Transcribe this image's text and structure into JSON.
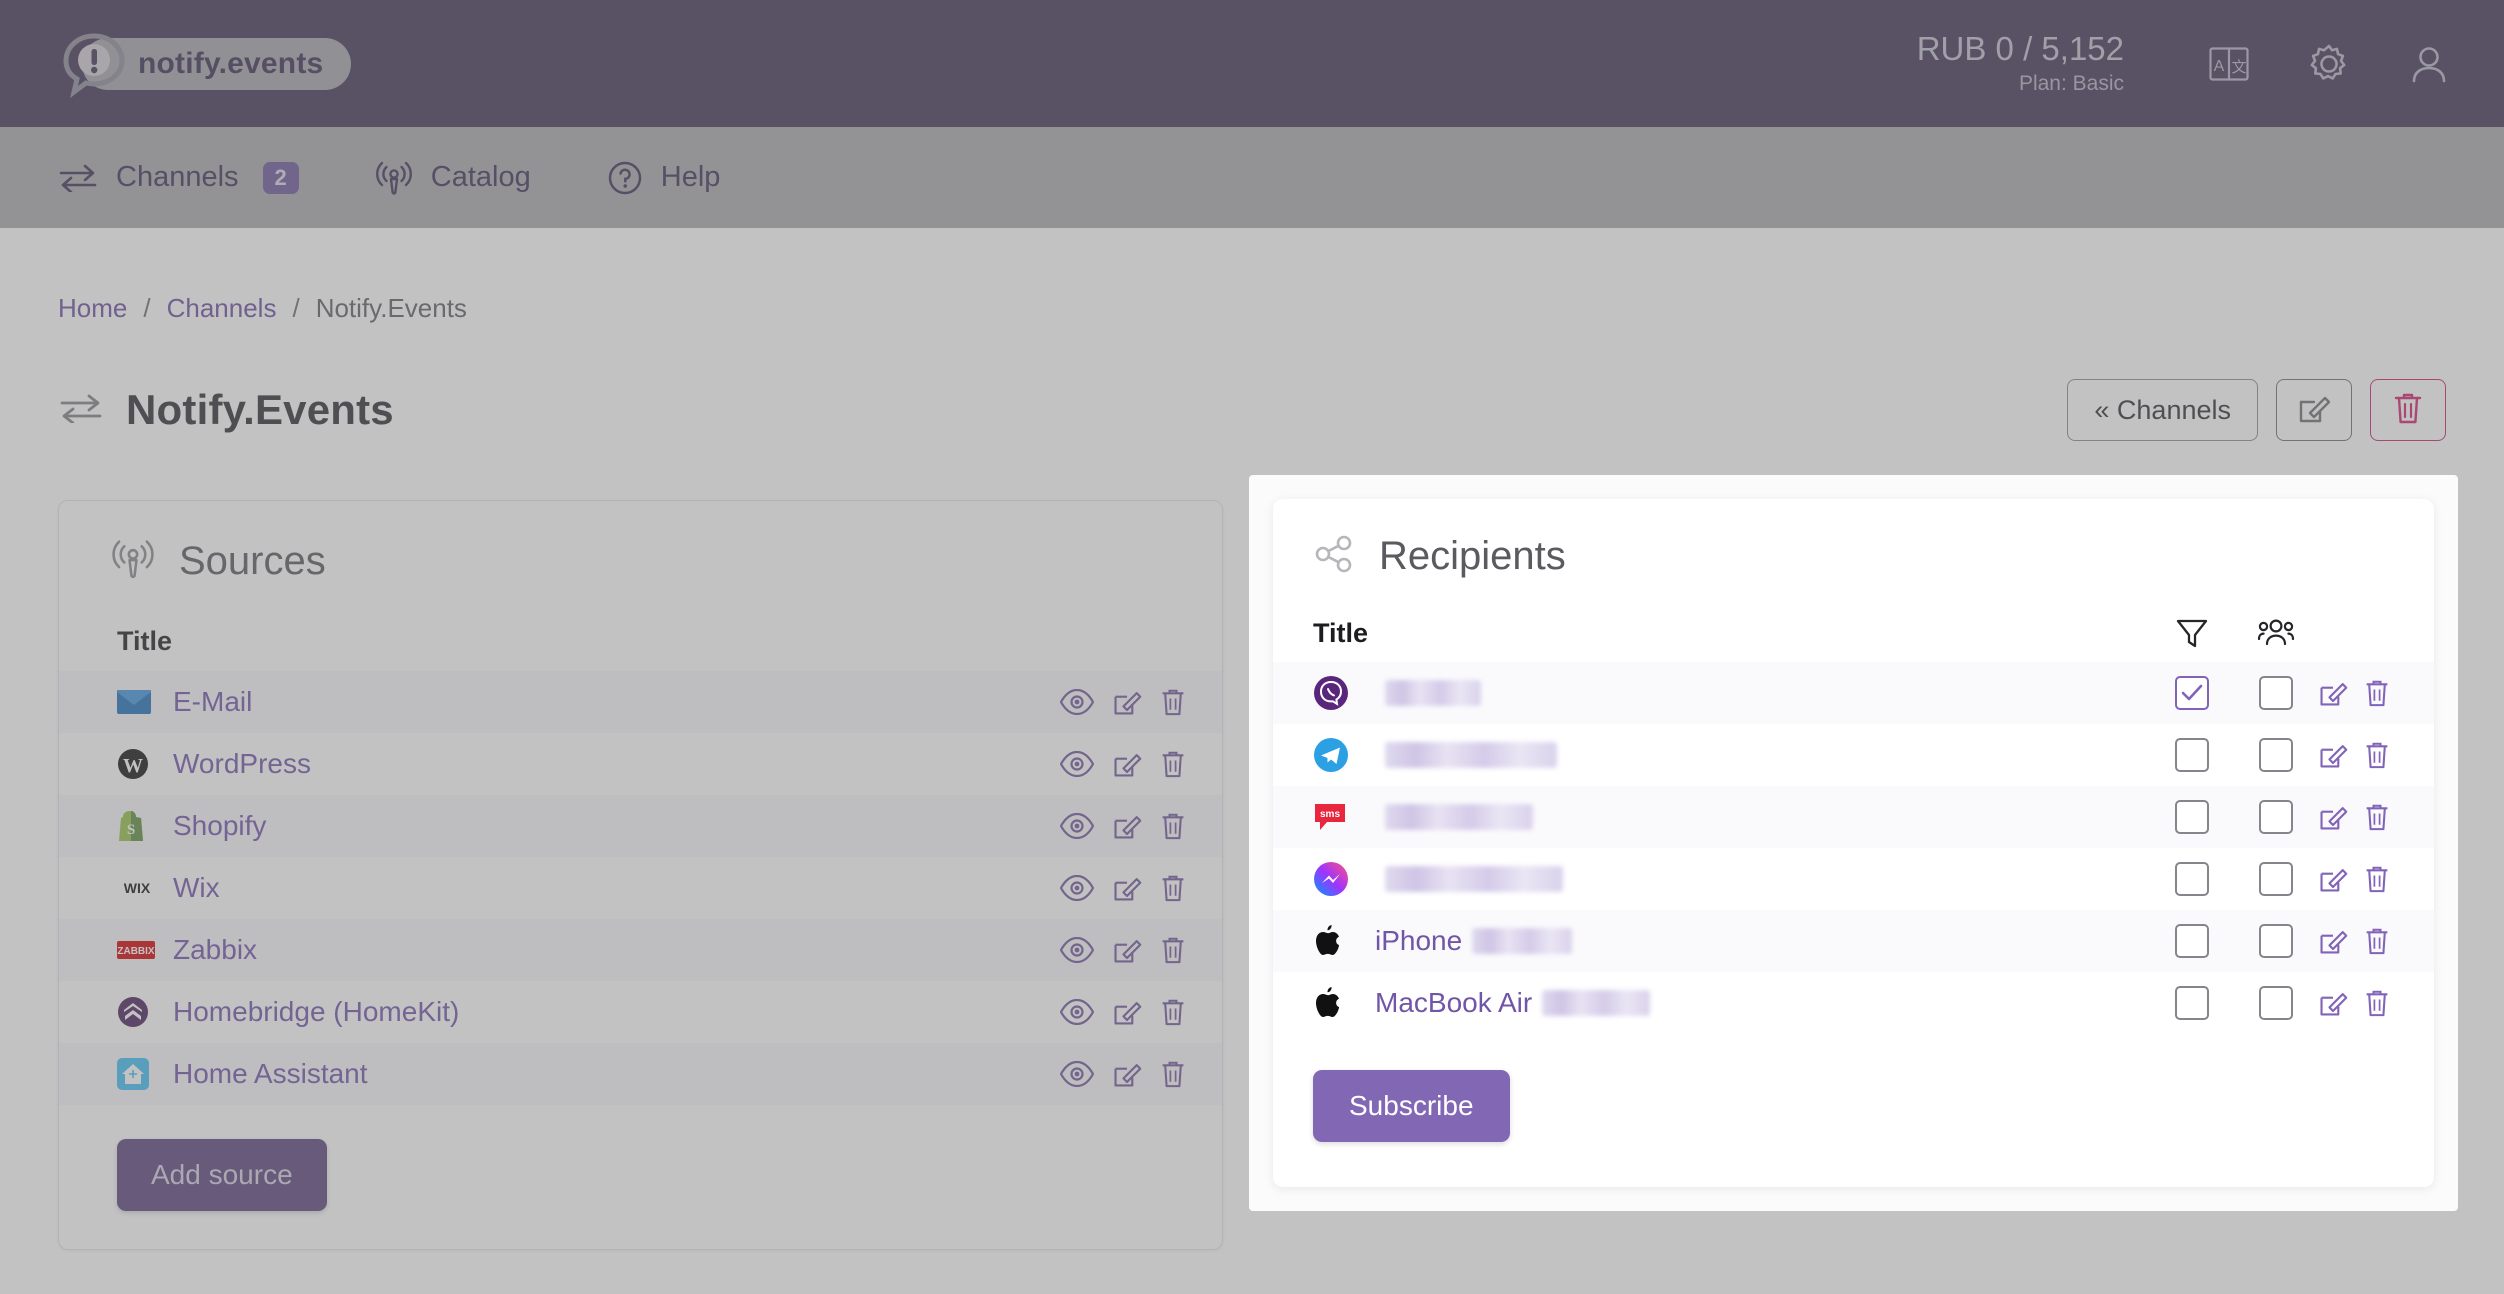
{
  "header": {
    "brand": "notify.events",
    "logo_icon": "notification-bubble-icon",
    "balance": "RUB 0 / 5,152",
    "plan": "Plan: Basic",
    "icons": [
      "translate-icon",
      "gear-icon",
      "user-icon"
    ]
  },
  "nav": {
    "items": [
      {
        "label": "Channels",
        "icon": "exchange-arrows-icon",
        "badge": "2"
      },
      {
        "label": "Catalog",
        "icon": "broadcast-icon",
        "badge": ""
      },
      {
        "label": "Help",
        "icon": "question-circle-icon",
        "badge": ""
      }
    ]
  },
  "breadcrumb": {
    "home": "Home",
    "channels": "Channels",
    "current": "Notify.Events",
    "separator": "/"
  },
  "page": {
    "title": "Notify.Events",
    "title_icon": "exchange-arrows-icon",
    "back_button": "« Channels",
    "edit_button_icon": "edit-icon",
    "delete_button_icon": "trash-icon"
  },
  "sources": {
    "heading": "Sources",
    "heading_icon": "broadcast-icon",
    "column_title": "Title",
    "add_button": "Add source",
    "row_actions": [
      "view-icon",
      "edit-icon",
      "trash-icon"
    ],
    "items": [
      {
        "title": "E-Mail",
        "icon": "email-icon"
      },
      {
        "title": "WordPress",
        "icon": "wordpress-icon"
      },
      {
        "title": "Shopify",
        "icon": "shopify-icon"
      },
      {
        "title": "Wix",
        "icon": "wix-icon"
      },
      {
        "title": "Zabbix",
        "icon": "zabbix-icon"
      },
      {
        "title": "Homebridge (HomeKit)",
        "icon": "homebridge-icon"
      },
      {
        "title": "Home Assistant",
        "icon": "home-assistant-icon"
      }
    ]
  },
  "recipients": {
    "heading": "Recipients",
    "heading_icon": "share-nodes-icon",
    "column_title": "Title",
    "column_filter_icon": "filter-icon",
    "column_group_icon": "people-group-icon",
    "subscribe_button": "Subscribe",
    "row_actions": [
      "edit-icon",
      "trash-icon"
    ],
    "items": [
      {
        "name": "",
        "icon": "viber-icon",
        "redacted": true,
        "redact_width": 96,
        "filter_checked": true,
        "group_checked": false
      },
      {
        "name": "",
        "icon": "telegram-icon",
        "redacted": true,
        "redact_width": 172,
        "filter_checked": false,
        "group_checked": false
      },
      {
        "name": "",
        "icon": "sms-icon",
        "redacted": true,
        "redact_width": 148,
        "filter_checked": false,
        "group_checked": false
      },
      {
        "name": "",
        "icon": "messenger-icon",
        "redacted": true,
        "redact_width": 178,
        "filter_checked": false,
        "group_checked": false
      },
      {
        "name": "iPhone",
        "icon": "apple-icon",
        "redacted": true,
        "redact_width": 100,
        "filter_checked": false,
        "group_checked": false
      },
      {
        "name": "MacBook Air",
        "icon": "apple-icon",
        "redacted": true,
        "redact_width": 108,
        "filter_checked": false,
        "group_checked": false
      }
    ]
  },
  "colors": {
    "header_bg": "#3e3353",
    "nav_bg": "#a9a9ab",
    "accent_purple": "#6d5699",
    "link_purple": "#7055a8",
    "subscribe": "#8267b5",
    "add_source": "#59437d",
    "danger": "#d6206e"
  }
}
